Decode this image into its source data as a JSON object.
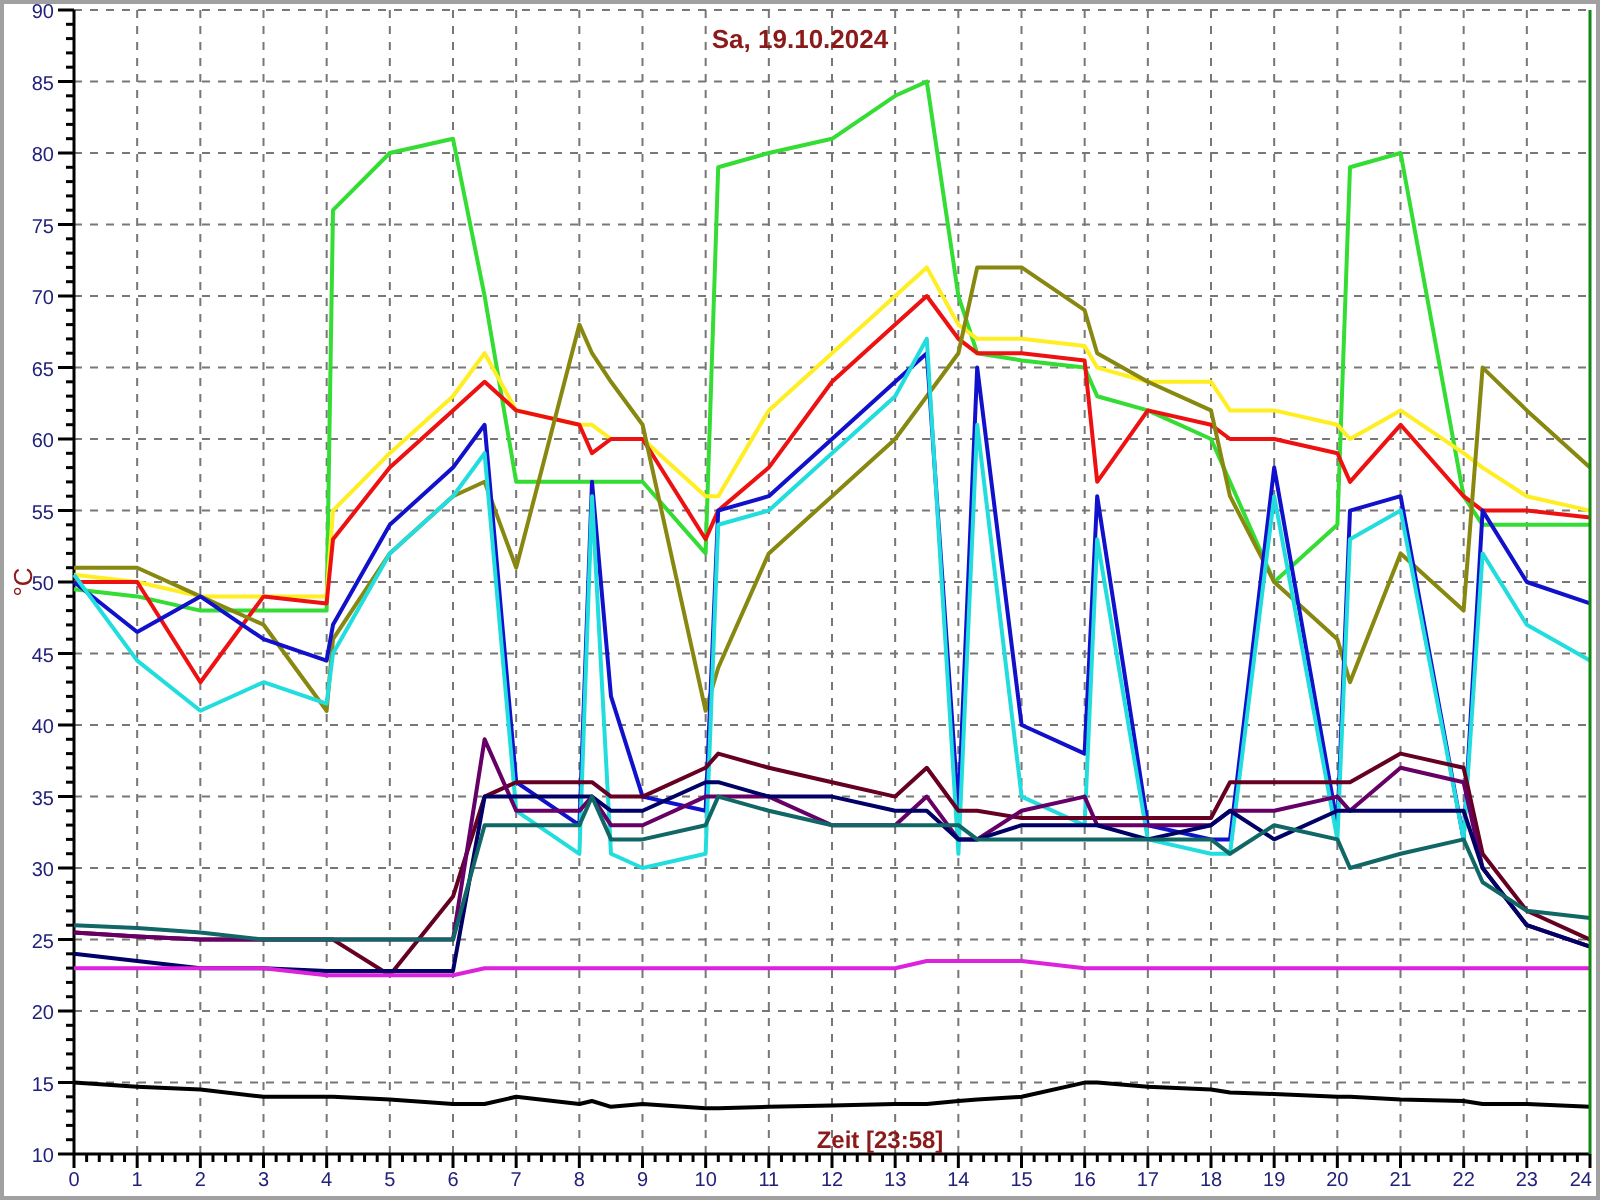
{
  "chart_data": {
    "type": "line",
    "title": "Sa, 19.10.2024",
    "xlabel": "Zeit [23:58]",
    "ylabel": "°C",
    "grid": true,
    "xlim": [
      0,
      24
    ],
    "ylim": [
      10,
      90
    ],
    "xticks": [
      0,
      1,
      2,
      3,
      4,
      5,
      6,
      7,
      8,
      9,
      10,
      11,
      12,
      13,
      14,
      15,
      16,
      17,
      18,
      19,
      20,
      21,
      22,
      23,
      24
    ],
    "yticks": [
      10,
      15,
      20,
      25,
      30,
      35,
      40,
      45,
      50,
      55,
      60,
      65,
      70,
      75,
      80,
      85,
      90
    ],
    "x": [
      0,
      1,
      2,
      3,
      4,
      4.1,
      5,
      6,
      6.5,
      7,
      8,
      8.2,
      8.5,
      9,
      10,
      10.2,
      11,
      12,
      13,
      13.5,
      14,
      14.3,
      15,
      16,
      16.2,
      17,
      18,
      18.3,
      19,
      20,
      20.2,
      21,
      22,
      22.3,
      23,
      24
    ],
    "series": [
      {
        "color": "#33dd33",
        "values": [
          49.5,
          49,
          48,
          48,
          48,
          76,
          80,
          81,
          70,
          57,
          57,
          57,
          57,
          57,
          52,
          79,
          80,
          81,
          84,
          85,
          70,
          66,
          65.5,
          65,
          63,
          62,
          60,
          57,
          50,
          54,
          79,
          80,
          56,
          54,
          54,
          54
        ]
      },
      {
        "color": "#ffee22",
        "values": [
          50.5,
          50,
          49,
          49,
          49,
          55,
          59,
          63,
          66,
          62,
          61,
          61,
          60,
          60,
          56,
          56,
          62,
          66,
          70,
          72,
          68,
          67,
          67,
          66.5,
          65,
          64,
          64,
          62,
          62,
          61,
          60,
          62,
          59,
          58,
          56,
          55
        ]
      },
      {
        "color": "#ee1111",
        "values": [
          50,
          50,
          43,
          49,
          48.5,
          53,
          58,
          62,
          64,
          62,
          61,
          59,
          60,
          60,
          53,
          55,
          58,
          64,
          68,
          70,
          67,
          66,
          66,
          65.5,
          57,
          62,
          61,
          60,
          60,
          59,
          57,
          61,
          56,
          55,
          55,
          54.5
        ]
      },
      {
        "color": "#888811",
        "values": [
          51,
          51,
          49,
          47,
          41,
          46,
          52,
          56,
          57,
          51,
          68,
          66,
          64,
          61,
          41,
          44,
          52,
          56,
          60,
          63,
          66,
          72,
          72,
          69,
          66,
          64,
          62,
          56,
          50,
          46,
          43,
          52,
          48,
          65,
          62,
          58
        ]
      },
      {
        "color": "#1111cc",
        "values": [
          50,
          46.5,
          49,
          46,
          44.5,
          47,
          54,
          58,
          61,
          36,
          33,
          57,
          42,
          35,
          34,
          55,
          56,
          60,
          64,
          66,
          34,
          65,
          40,
          38,
          56,
          33,
          32,
          32,
          58,
          33,
          55,
          56,
          32,
          55,
          50,
          48.5
        ]
      },
      {
        "color": "#22dddd",
        "values": [
          50.5,
          44.5,
          41,
          43,
          41.5,
          45,
          52,
          56,
          59,
          34,
          31,
          56,
          31,
          30,
          31,
          54,
          55,
          59,
          63,
          67,
          31,
          61,
          35,
          33,
          53,
          32,
          31,
          31,
          56,
          32,
          53,
          55,
          32,
          52,
          47,
          44.5
        ]
      },
      {
        "color": "#660022",
        "values": [
          25.5,
          25.2,
          25,
          25,
          25,
          25,
          22.5,
          28,
          35,
          36,
          36,
          36,
          35,
          35,
          37,
          38,
          37,
          36,
          35,
          37,
          34,
          34,
          33.5,
          33.5,
          33.5,
          33.5,
          33.5,
          36,
          36,
          36,
          36,
          38,
          37,
          31,
          27,
          25
        ]
      },
      {
        "color": "#660066",
        "values": [
          25.5,
          25.2,
          25,
          25,
          25,
          25,
          25,
          25,
          39,
          34,
          34,
          35,
          33,
          33,
          35,
          35,
          35,
          33,
          33,
          35,
          32,
          32,
          34,
          35,
          33,
          33,
          33,
          34,
          34,
          35,
          34,
          37,
          36,
          30,
          26,
          24.5
        ]
      },
      {
        "color": "#000066",
        "values": [
          24,
          23.5,
          23,
          23,
          22.8,
          22.8,
          22.8,
          22.8,
          35,
          35,
          35,
          35,
          34,
          34,
          36,
          36,
          35,
          35,
          34,
          34,
          32,
          32,
          33,
          33,
          33,
          32,
          33,
          34,
          32,
          34,
          34,
          34,
          34,
          30,
          26,
          24.5
        ]
      },
      {
        "color": "#116666",
        "values": [
          26,
          25.8,
          25.5,
          25,
          25,
          25,
          25,
          25,
          33,
          33,
          33,
          35,
          32,
          32,
          33,
          35,
          34,
          33,
          33,
          33,
          33,
          32,
          32,
          32,
          32,
          32,
          32,
          31,
          33,
          32,
          30,
          31,
          32,
          29,
          27,
          26.5
        ]
      },
      {
        "color": "#dd22dd",
        "values": [
          23,
          23,
          23,
          23,
          22.5,
          22.5,
          22.5,
          22.5,
          23,
          23,
          23,
          23,
          23,
          23,
          23,
          23,
          23,
          23,
          23,
          23.5,
          23.5,
          23.5,
          23.5,
          23,
          23,
          23,
          23,
          23,
          23,
          23,
          23,
          23,
          23,
          23,
          23,
          23
        ]
      },
      {
        "color": "#000000",
        "values": [
          15,
          14.7,
          14.5,
          14,
          14,
          14,
          13.8,
          13.5,
          13.5,
          14,
          13.5,
          13.7,
          13.3,
          13.5,
          13.2,
          13.2,
          13.3,
          13.4,
          13.5,
          13.5,
          13.7,
          13.8,
          14,
          15,
          15,
          14.7,
          14.5,
          14.3,
          14.2,
          14,
          14,
          13.8,
          13.7,
          13.5,
          13.5,
          13.3
        ]
      }
    ]
  }
}
